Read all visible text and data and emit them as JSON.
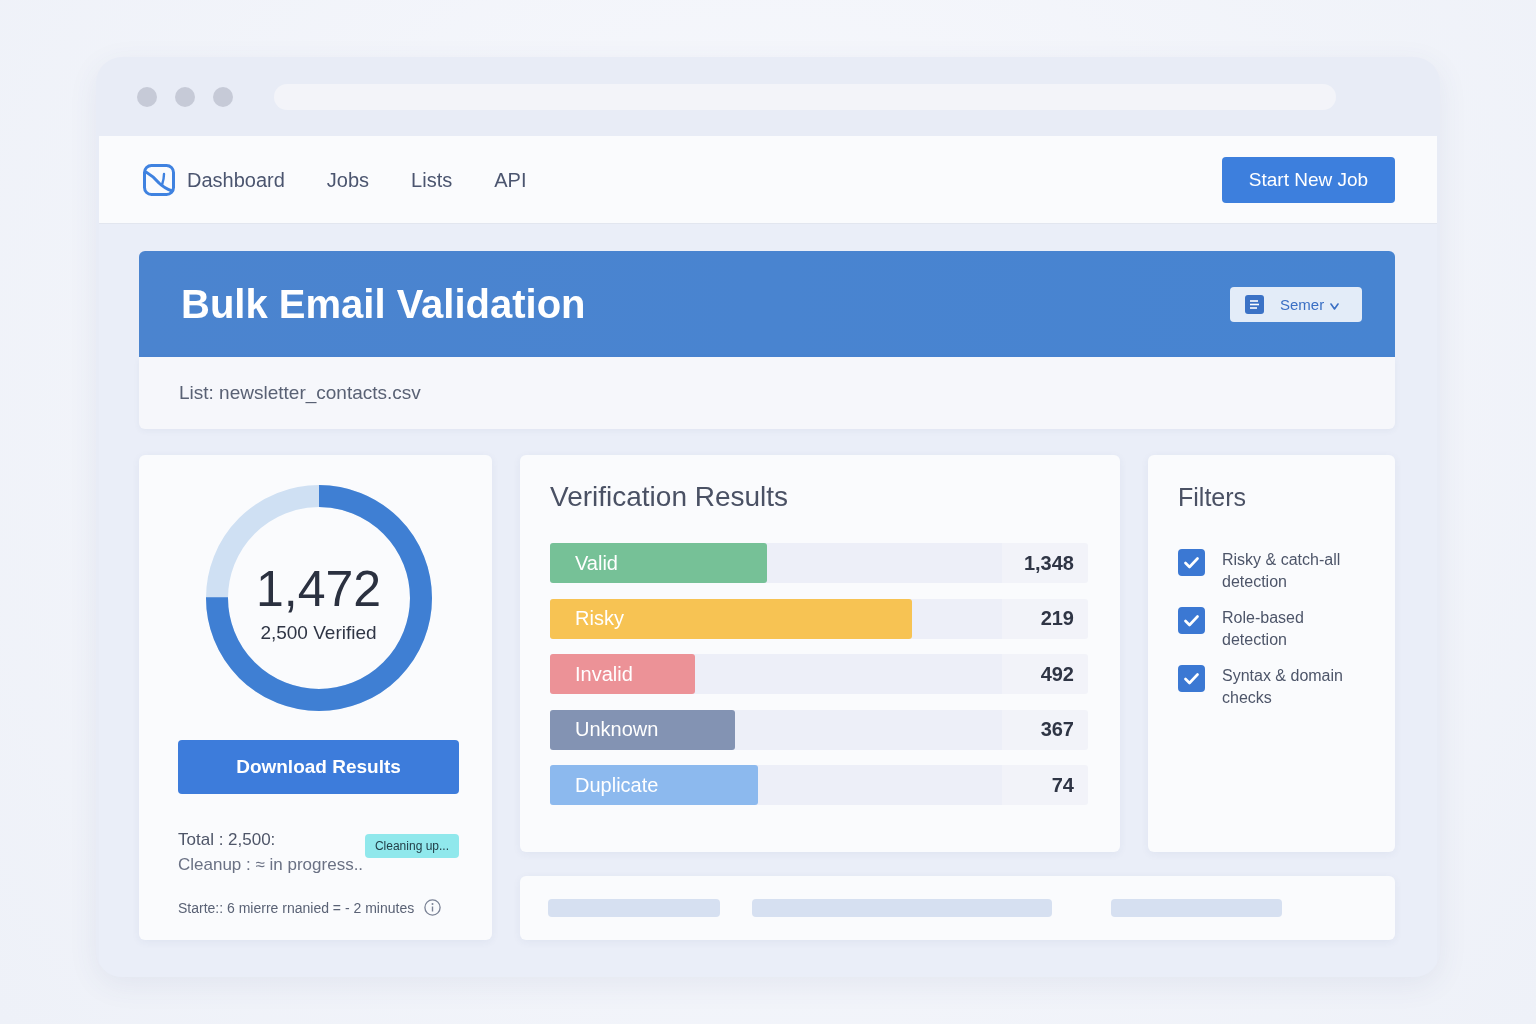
{
  "nav": {
    "links": [
      "Dashboard",
      "Jobs",
      "Lists",
      "API"
    ],
    "action": "Start New Job"
  },
  "header": {
    "title": "Bulk Email Validation",
    "dropdown": "Semer",
    "list": "List: newsletter_contacts.csv"
  },
  "summary": {
    "ring": {
      "level": 0.75,
      "value": "1,472",
      "caption": "2,500 Verified"
    },
    "download_button": "Download Results",
    "total": "Total : 2,500:",
    "cleanup": "Cleanup : ≈ in progress..",
    "badge": "Cleaning up...",
    "started": "Starte:: 6 mierre rnanied = - 2 minutes"
  },
  "results": {
    "title": "Verification Results",
    "rows": [
      {
        "label": "Valid",
        "count": "1,348",
        "level": 0.48,
        "color": "#76c197"
      },
      {
        "label": "Risky",
        "count": "219",
        "level": 0.8,
        "color": "#f7c353"
      },
      {
        "label": "Invalid",
        "count": "492",
        "level": 0.32,
        "color": "#ec9297"
      },
      {
        "label": "Unknown",
        "count": "367",
        "level": 0.41,
        "color": "#8393b3"
      },
      {
        "label": "Duplicate",
        "count": "74",
        "level": 0.46,
        "color": "#8cb9ee"
      }
    ]
  },
  "filters": {
    "title": "Filters",
    "options": [
      {
        "label": "Risky & catch-all detection",
        "checked": true
      },
      {
        "label": "Role-based detection",
        "checked": true
      },
      {
        "label": "Syntax & domain checks",
        "checked": true
      }
    ]
  }
}
